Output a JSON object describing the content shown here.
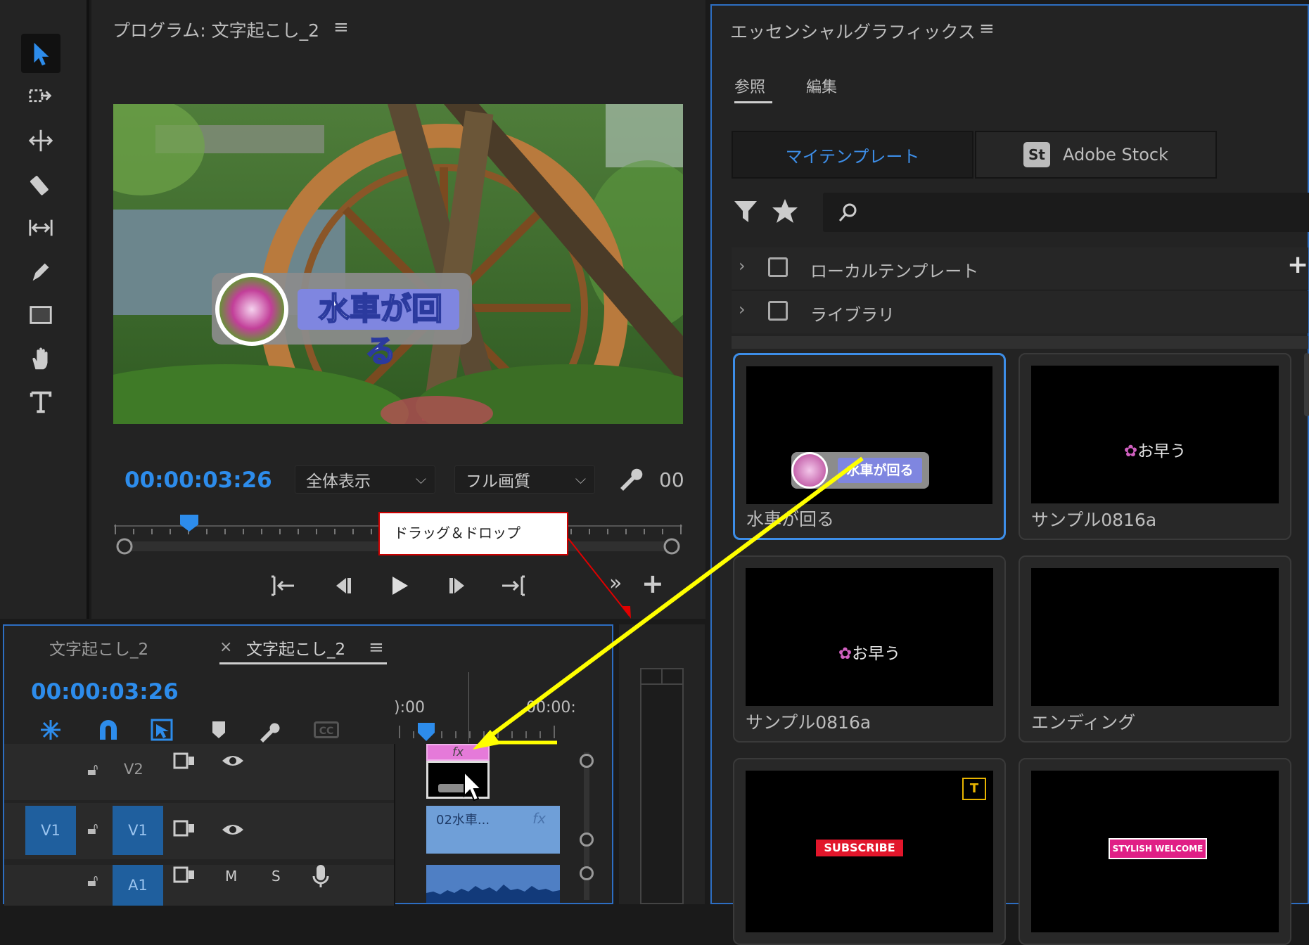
{
  "program": {
    "title": "プログラム: 文字起こし_2",
    "menu_icon": "≡",
    "timecode": "00:00:03:26",
    "zoom_select": "全体表示",
    "quality_select": "フル画質",
    "timecode_right": "00",
    "overlay_title_text": "水車が回る"
  },
  "annotation": {
    "callout_text": "ドラッグ＆ドロップ",
    "arrow_color": "#ffff00",
    "callout_border": "#cc0000"
  },
  "essential_graphics": {
    "title": "エッセンシャルグラフィックス",
    "menu_icon": "≡",
    "tabs": [
      {
        "label": "参照",
        "active": true
      },
      {
        "label": "編集",
        "active": false
      }
    ],
    "source_tabs": [
      {
        "label": "マイテンプレート",
        "active": true
      },
      {
        "label": "Adobe Stock",
        "active": false,
        "badge": "St"
      }
    ],
    "search_placeholder": "",
    "folders": [
      {
        "label": "ローカルテンプレート"
      },
      {
        "label": "ライブラリ"
      }
    ],
    "add_button": "+",
    "templates": [
      {
        "label": "水車が回る",
        "selected": true,
        "thumb_text": "水車が回る"
      },
      {
        "label": "サンプル0816a",
        "selected": false,
        "thumb_text": "お早う"
      },
      {
        "label": "サンプル0816a",
        "selected": false,
        "thumb_text": "お早う"
      },
      {
        "label": "エンディング",
        "selected": false,
        "thumb_text": ""
      },
      {
        "label": "",
        "selected": false,
        "thumb_text": "SUBSCRIBE"
      },
      {
        "label": "",
        "selected": false,
        "thumb_text": "STYLISH WELCOME"
      }
    ]
  },
  "timeline": {
    "tabs": [
      {
        "label": "文字起こし_2",
        "active": false
      },
      {
        "label": "文字起こし_2",
        "active": true,
        "close": "×"
      }
    ],
    "menu_icon": "≡",
    "timecode": "00:00:03:26",
    "ruler_left": "):00",
    "ruler_right": "00:00:",
    "tracks": {
      "v2": {
        "label": "V2"
      },
      "v1": {
        "src_label": "V1",
        "label": "V1",
        "clip_name": "02水車..."
      },
      "a1": {
        "label": "A1",
        "mute": "M",
        "solo": "S"
      }
    },
    "fx_badge": "fx",
    "graphic_clip_badge": "fx"
  },
  "colors": {
    "accent_blue": "#2d8ceb",
    "selection_border": "#3d8ee8",
    "graphic_clip": "#e57ad9",
    "video_clip": "#6f9fd8",
    "audio_clip": "#4f7fc4"
  }
}
